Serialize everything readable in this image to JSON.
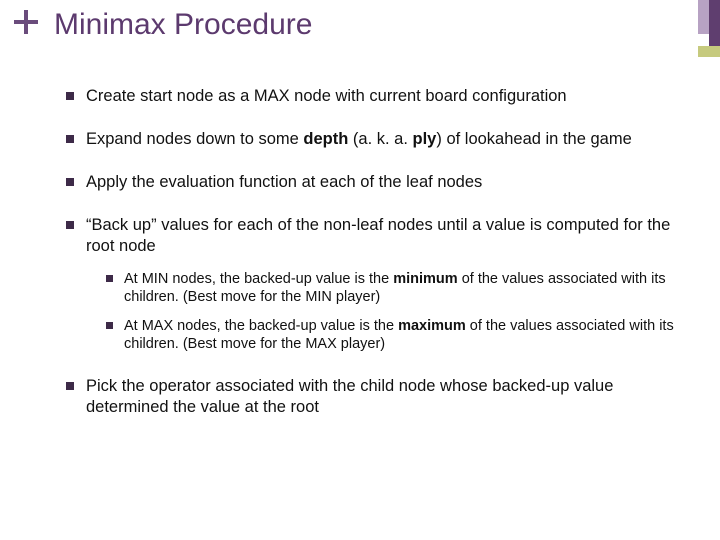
{
  "title": "Minimax Procedure",
  "bullets": {
    "b1": "Create start node as a MAX node  with current board configuration",
    "b2a": "Expand nodes down to some ",
    "b2_depth": "depth",
    "b2b": " (a. k. a. ",
    "b2_ply": "ply",
    "b2c": ") of lookahead in the game",
    "b3": "Apply the evaluation function at each of the leaf nodes",
    "b4": "“Back up” values for each of the non-leaf nodes until a value is computed for the root node",
    "b4_s1a": "At MIN nodes, the backed-up value is the ",
    "b4_s1_min": "minimum",
    "b4_s1b": " of the values associated with its children.  (Best move for the MIN player)",
    "b4_s2a": "At MAX nodes, the backed-up value is the ",
    "b4_s2_max": "maximum",
    "b4_s2b": " of the values associated with its children.  (Best move for the MAX player)",
    "b5": "Pick the operator associated with the child node whose backed-up value determined the value at the root"
  }
}
